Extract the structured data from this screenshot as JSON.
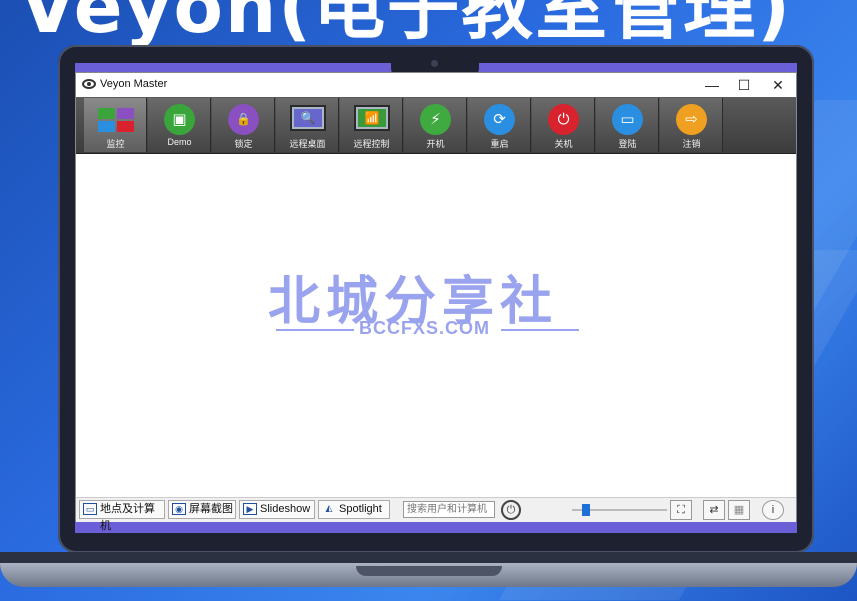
{
  "banner": {
    "title": "Veyon(电子教室管理)"
  },
  "window": {
    "title": "Veyon Master",
    "controls": {
      "minimize": "—",
      "maximize": "☐",
      "close": "✕"
    }
  },
  "toolbar": {
    "items": [
      {
        "label": "监控",
        "icon": "monitor-grid-icon"
      },
      {
        "label": "Demo",
        "icon": "presentation-icon",
        "glyph": "▣",
        "color": "#3aa53a"
      },
      {
        "label": "锁定",
        "icon": "lock-icon",
        "glyph": "🔒",
        "color": "#8a4fc0"
      },
      {
        "label": "远程桌面",
        "icon": "remote-desktop-icon",
        "glyph": "🔍"
      },
      {
        "label": "远程控制",
        "icon": "remote-control-icon",
        "glyph": "📶"
      },
      {
        "label": "开机",
        "icon": "power-on-icon",
        "glyph": "⚡",
        "color": "#3faa3f"
      },
      {
        "label": "重启",
        "icon": "reboot-icon",
        "glyph": "⟳",
        "color": "#2a8fe0"
      },
      {
        "label": "关机",
        "icon": "shutdown-icon",
        "glyph": "⏻",
        "color": "#d8232e"
      },
      {
        "label": "登陆",
        "icon": "login-icon",
        "glyph": "▭",
        "color": "#2a8fe0"
      },
      {
        "label": "注销",
        "icon": "logout-icon",
        "glyph": "⇨",
        "color": "#f0a020"
      }
    ]
  },
  "watermark": {
    "cn": "北城分享社",
    "en": "BCCFXS.COM"
  },
  "statusbar": {
    "locations_button": "地点及计算机",
    "screenshots_button": "屏幕截图",
    "slideshow_button": "Slideshow",
    "spotlight_button": "Spotlight",
    "search_placeholder": "搜索用户和计算机",
    "power_glyph": "⏻",
    "zoom_level": 0.15
  }
}
